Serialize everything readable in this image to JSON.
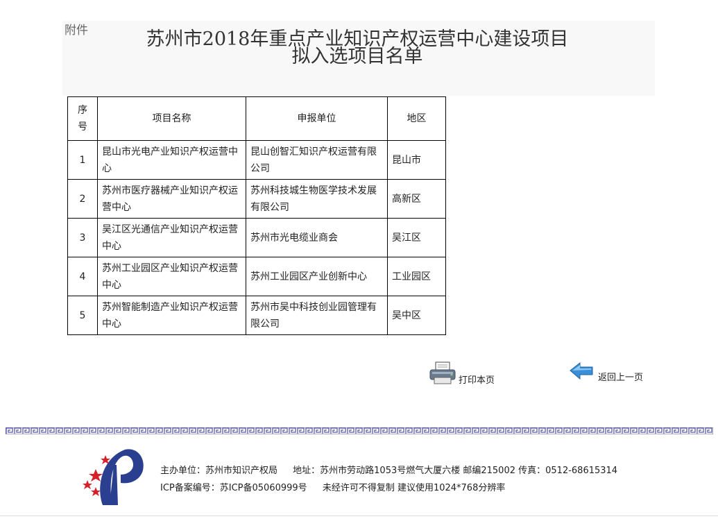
{
  "header": {
    "attachment_label": "附件",
    "title_line1": "苏州市2018年重点产业知识产权运营中心建设项目",
    "title_line2": "拟入选项目名单"
  },
  "table": {
    "columns": [
      "序号",
      "项目名称",
      "申报单位",
      "地区"
    ],
    "rows": [
      {
        "no": "1",
        "project": "昆山市光电产业知识产权运营中心",
        "unit": "昆山创智汇知识产权运营有限公司",
        "region": "昆山市"
      },
      {
        "no": "2",
        "project": "苏州市医疗器械产业知识产权运营中心",
        "unit": "苏州科技城生物医学技术发展有限公司",
        "region": "高新区"
      },
      {
        "no": "3",
        "project": "吴江区光通信产业知识产权运营中心",
        "unit": "苏州市光电缆业商会",
        "region": "吴江区"
      },
      {
        "no": "4",
        "project": "苏州工业园区产业知识产权运营中心",
        "unit": "苏州工业园区产业创新中心",
        "region": "工业园区"
      },
      {
        "no": "5",
        "project": "苏州智能制造产业知识产权运营中心",
        "unit": "苏州市吴中科技创业园管理有限公司",
        "region": "吴中区"
      }
    ]
  },
  "actions": {
    "print_label": "打印本页",
    "back_label": "返回上一页",
    "print_icon": "printer-icon",
    "back_icon": "arrow-left-icon"
  },
  "footer": {
    "host": "主办单位：苏州市知识产权局",
    "address": "地址：苏州市劳动路1053号燃气大厦六楼 邮编215002 传真：0512-68615314",
    "icp": "ICP备案编号：苏ICP备05060999号",
    "notice": "未经许可不得复制 建议使用1024*768分辨率",
    "logo_icon": "ipo-logo-icon"
  },
  "colors": {
    "divider": "#5a5aa8",
    "logo_blue": "#2a3f8f",
    "logo_red": "#d8202a",
    "arrow_blue": "#3a8fd8"
  }
}
